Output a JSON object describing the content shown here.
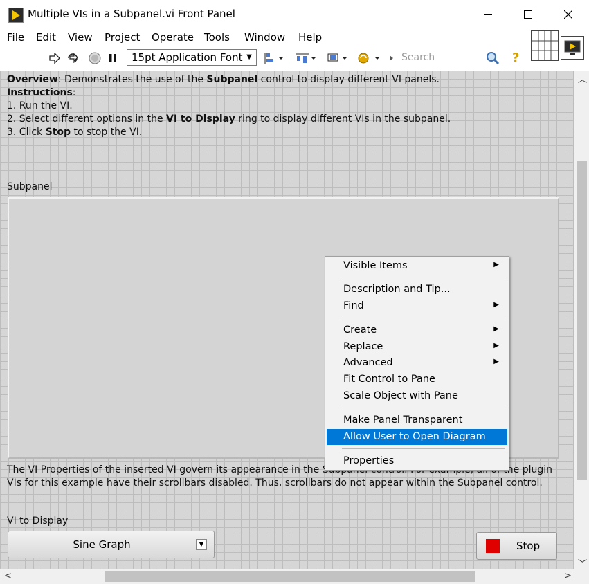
{
  "window": {
    "title": "Multiple VIs in a Subpanel.vi Front Panel"
  },
  "menu": [
    "File",
    "Edit",
    "View",
    "Project",
    "Operate",
    "Tools",
    "Window",
    "Help"
  ],
  "toolbar": {
    "font": "15pt Application Font",
    "search_placeholder": "Search"
  },
  "overview": {
    "overview_label": "Overview",
    "overview_text_a": ": Demonstrates the use of the ",
    "overview_bold": "Subpanel",
    "overview_text_b": " control to display different VI panels.",
    "instructions_label": "Instructions",
    "instructions_colon": ":",
    "step1": "1. Run the VI.",
    "step2_a": "2. Select different options in the ",
    "step2_bold": "VI to Display",
    "step2_b": " ring to display different VIs in the subpanel.",
    "step3_a": "3. Click ",
    "step3_bold": "Stop",
    "step3_b": " to stop the VI."
  },
  "subpanel": {
    "label": "Subpanel"
  },
  "footnote": {
    "line1": "The VI Properties of the inserted VI govern its appearance in the Subpanel control. For example, all of the plugin",
    "line2": "VIs for this example have their scrollbars disabled. Thus, scrollbars do not appear within the Subpanel control."
  },
  "vi_to_display": {
    "label": "VI to Display",
    "value": "Sine Graph"
  },
  "stop_button": {
    "label": "Stop"
  },
  "context_menu": {
    "visible_items": "Visible Items",
    "description_and_tip": "Description and Tip...",
    "find": "Find",
    "create": "Create",
    "replace": "Replace",
    "advanced": "Advanced",
    "fit_control": "Fit Control to Pane",
    "scale_object": "Scale Object with Pane",
    "make_transparent": "Make Panel Transparent",
    "allow_open_diagram": "Allow User to Open Diagram",
    "properties": "Properties"
  },
  "colors": {
    "selection": "#0078d7",
    "stop_indicator": "#e00000",
    "panel_grid": "#d6d6d6"
  }
}
